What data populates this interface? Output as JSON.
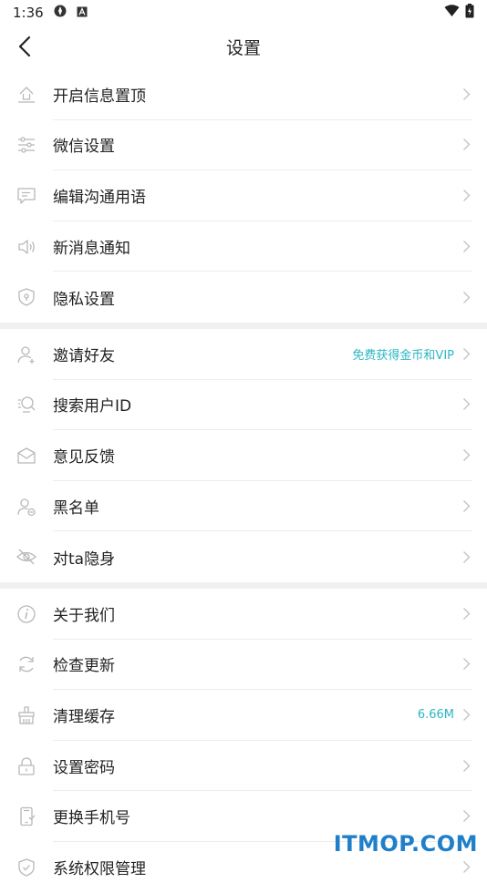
{
  "status_bar": {
    "time": "1:36"
  },
  "header": {
    "title": "设置"
  },
  "groups": [
    {
      "items": [
        {
          "label": "开启信息置顶",
          "icon": "pin-top-icon"
        },
        {
          "label": "微信设置",
          "icon": "sliders-icon"
        },
        {
          "label": "编辑沟通用语",
          "icon": "message-icon"
        },
        {
          "label": "新消息通知",
          "icon": "speaker-icon"
        },
        {
          "label": "隐私设置",
          "icon": "shield-icon"
        }
      ]
    },
    {
      "items": [
        {
          "label": "邀请好友",
          "icon": "add-user-icon",
          "extra": "免费获得金币和VIP"
        },
        {
          "label": "搜索用户ID",
          "icon": "search-user-icon"
        },
        {
          "label": "意见反馈",
          "icon": "envelope-icon"
        },
        {
          "label": "黑名单",
          "icon": "block-user-icon"
        },
        {
          "label": "对ta隐身",
          "icon": "eye-off-icon"
        }
      ]
    },
    {
      "items": [
        {
          "label": "关于我们",
          "icon": "info-icon"
        },
        {
          "label": "检查更新",
          "icon": "refresh-icon"
        },
        {
          "label": "清理缓存",
          "icon": "broom-icon",
          "extra": "6.66M"
        },
        {
          "label": "设置密码",
          "icon": "lock-icon"
        },
        {
          "label": "更换手机号",
          "icon": "phone-icon"
        },
        {
          "label": "系统权限管理",
          "icon": "permission-icon"
        }
      ]
    }
  ],
  "watermark": "ITMOP.COM",
  "colors": {
    "accent": "#2bb6c5",
    "icon": "#b8b8b8",
    "divider": "#ececec",
    "section_gap": "#f0f0f0"
  }
}
